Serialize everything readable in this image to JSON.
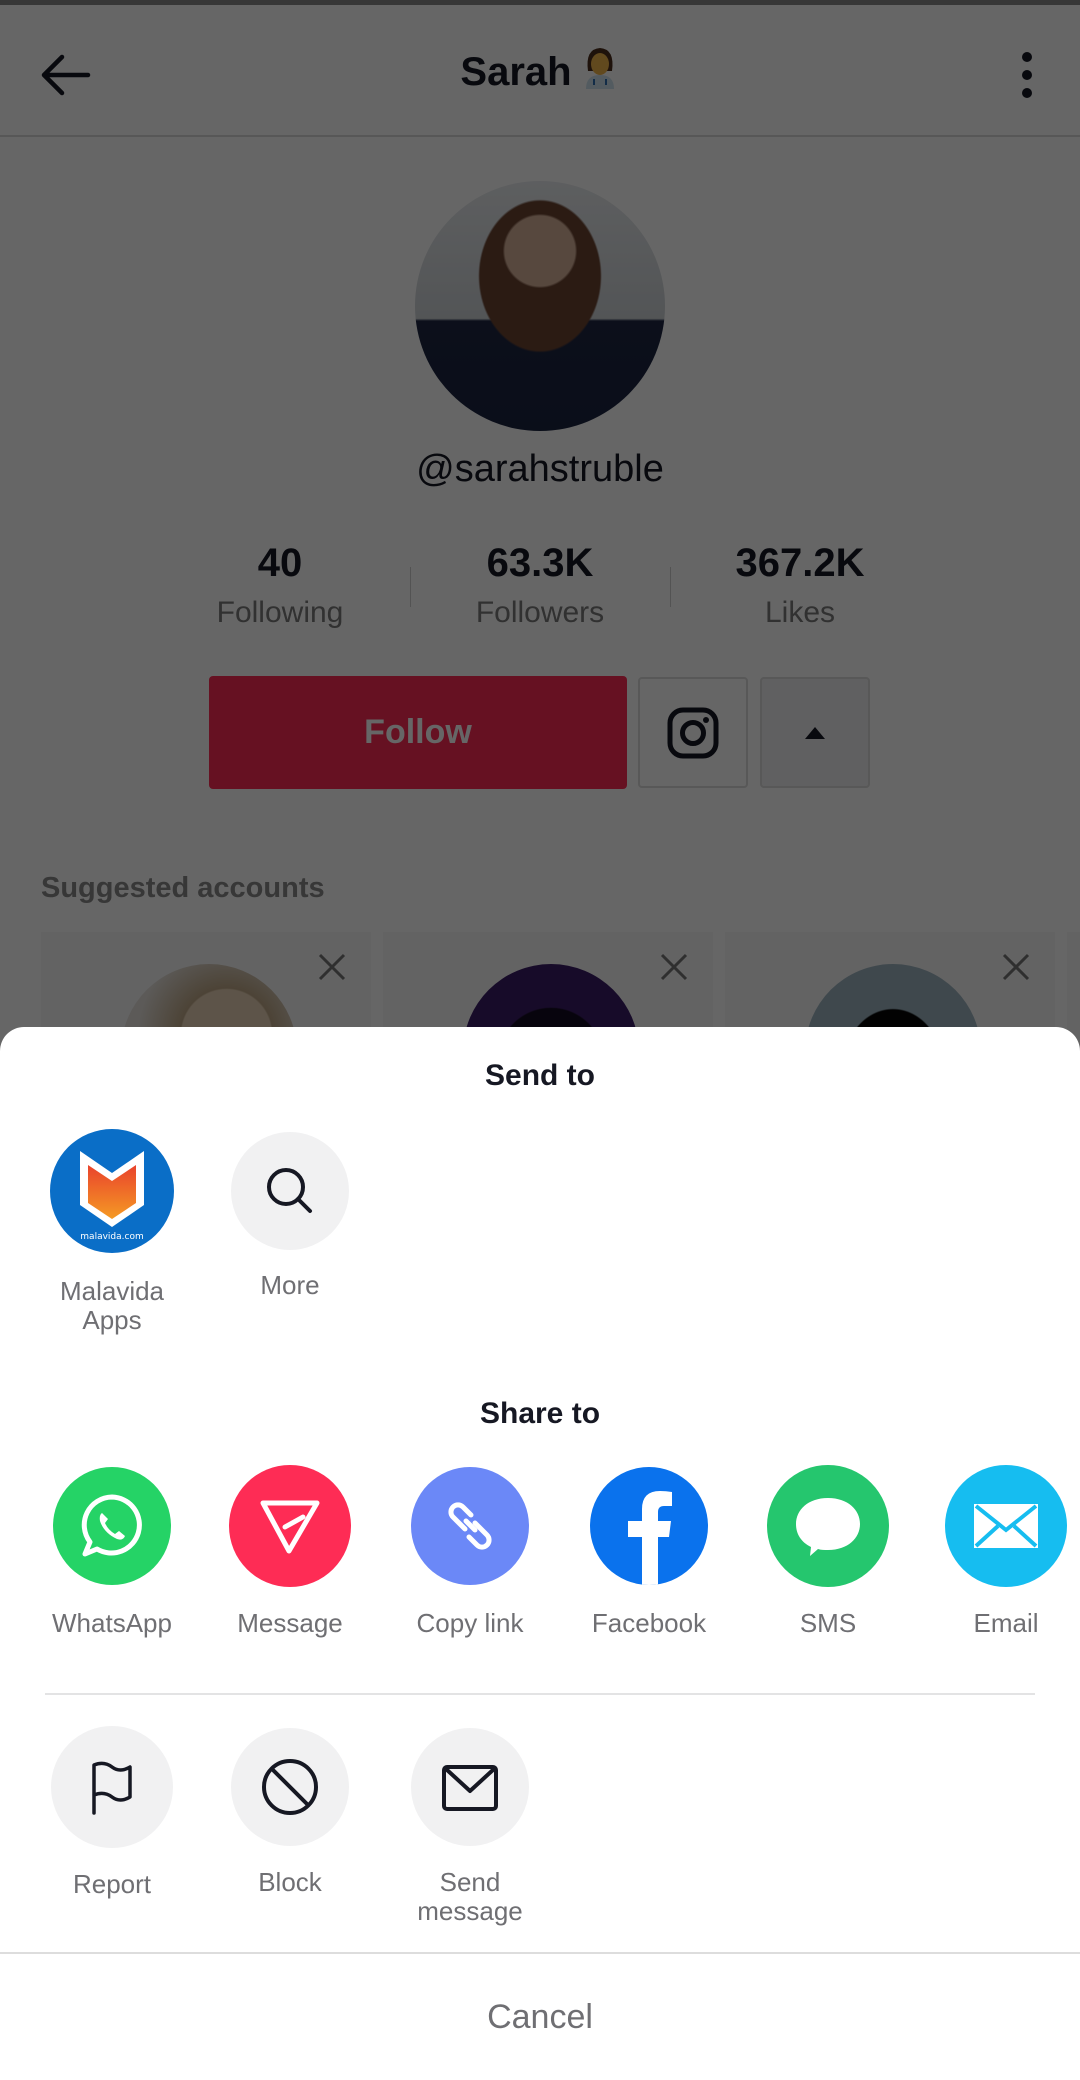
{
  "header": {
    "title": "Sarah",
    "title_emoji": "woman-health-worker-emoji",
    "back_icon": "arrow-left-icon",
    "more_icon": "vertical-dots-icon"
  },
  "profile": {
    "username": "@sarahstruble",
    "stats": [
      {
        "value": "40",
        "label": "Following"
      },
      {
        "value": "63.3K",
        "label": "Followers"
      },
      {
        "value": "367.2K",
        "label": "Likes"
      }
    ],
    "follow_label": "Follow",
    "instagram_icon": "instagram-icon",
    "expand_icon": "triangle-up-icon",
    "brand_color": "#fe2c55"
  },
  "suggested": {
    "title": "Suggested accounts",
    "cards": [
      {
        "dismiss_icon": "close-icon"
      },
      {
        "dismiss_icon": "close-icon"
      },
      {
        "dismiss_icon": "close-icon"
      }
    ]
  },
  "sheet": {
    "send_to_title": "Send to",
    "send_to": [
      {
        "label": "Malavida Apps",
        "line1": "Malavida",
        "line2": "Apps",
        "icon": "malavida-logo-icon",
        "logo_text": "malavida.com",
        "color": "#0a6ec7"
      },
      {
        "label": "More",
        "icon": "search-icon",
        "color": "#f1f1f2"
      }
    ],
    "share_to_title": "Share to",
    "share_to": [
      {
        "label": "WhatsApp",
        "icon": "whatsapp-icon",
        "color": "#25d366"
      },
      {
        "label": "Message",
        "icon": "send-message-icon",
        "color": "#fe2c55"
      },
      {
        "label": "Copy link",
        "icon": "link-icon",
        "color": "#6b88f7"
      },
      {
        "label": "Facebook",
        "icon": "facebook-icon",
        "color": "#0a72ed"
      },
      {
        "label": "SMS",
        "icon": "sms-bubble-icon",
        "color": "#25c66e"
      },
      {
        "label": "Email",
        "icon": "email-icon",
        "color": "#16bdf0"
      }
    ],
    "actions": [
      {
        "label": "Report",
        "icon": "flag-icon"
      },
      {
        "label": "Block",
        "icon": "block-icon"
      },
      {
        "label": "Send message",
        "line1": "Send",
        "line2": "message",
        "icon": "envelope-icon"
      }
    ],
    "cancel_label": "Cancel"
  }
}
